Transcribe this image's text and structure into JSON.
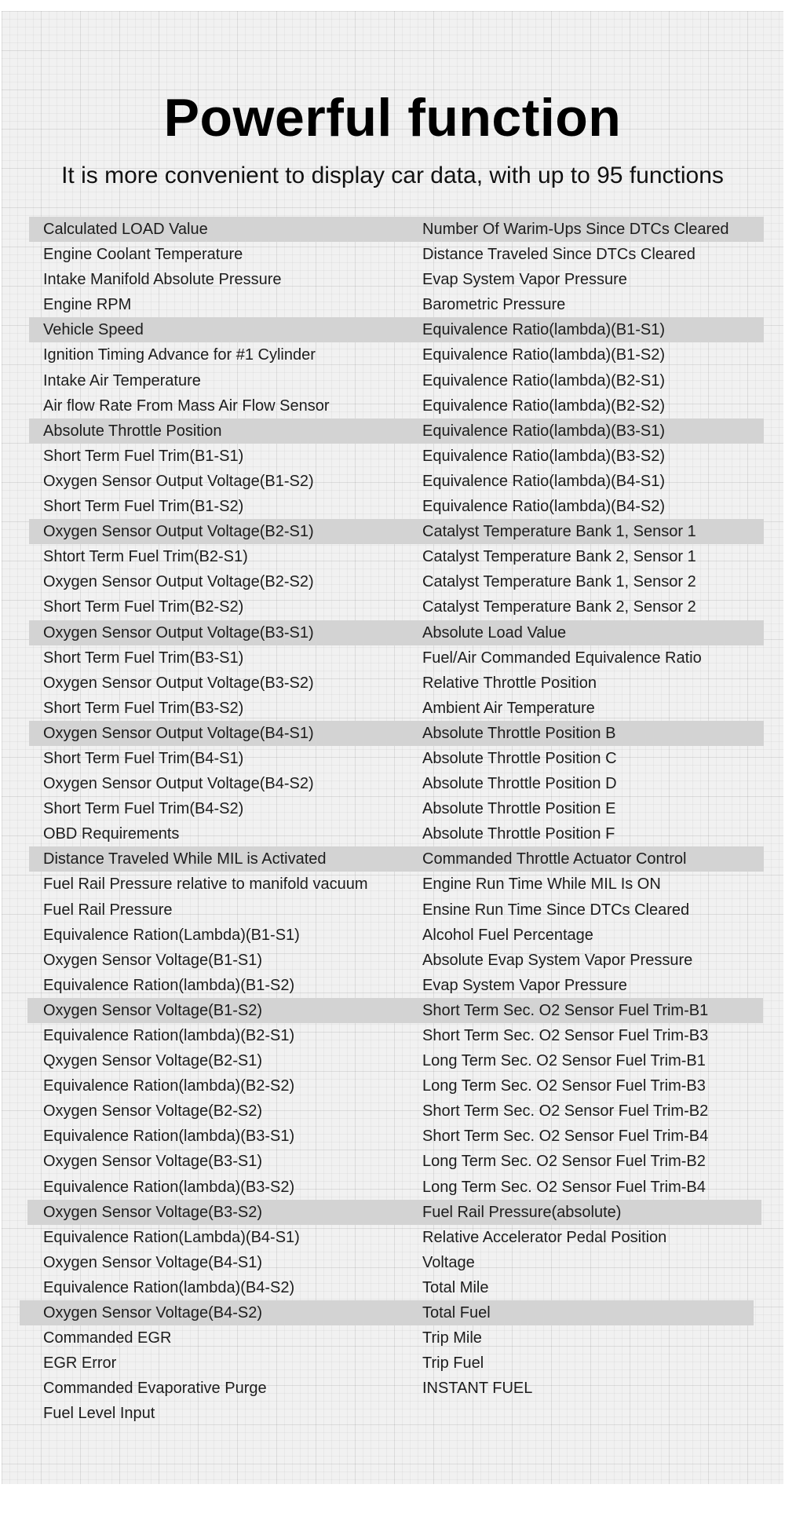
{
  "header": {
    "title": "Powerful function",
    "subtitle": "It is more convenient to display car data, with up to 95 functions"
  },
  "colors": {
    "highlight_band": "#d3d3d3",
    "panel_background": "#f1f1f1",
    "text": "#1c1c1c"
  },
  "functions": {
    "left_column": [
      "Calculated LOAD Value",
      "Engine Coolant Temperature",
      "Intake Manifold Absolute Pressure",
      "Engine RPM",
      "Vehicle Speed",
      "Ignition Timing Advance for #1 Cylinder",
      "Intake Air Temperature",
      "Air flow Rate From Mass Air Flow Sensor",
      "Absolute Throttle Position",
      "Short Term Fuel Trim(B1-S1)",
      "Oxygen Sensor Output Voltage(B1-S2)",
      "Short Term Fuel Trim(B1-S2)",
      "Oxygen Sensor Output Voltage(B2-S1)",
      "Shtort Term Fuel Trim(B2-S1)",
      "Oxygen Sensor Output Voltage(B2-S2)",
      "Short Term Fuel Trim(B2-S2)",
      "Oxygen Sensor Output Voltage(B3-S1)",
      "Short Term Fuel Trim(B3-S1)",
      "Oxygen Sensor Output Voltage(B3-S2)",
      "Short Term Fuel Trim(B3-S2)",
      "Oxygen Sensor Output Voltage(B4-S1)",
      "Short Term Fuel Trim(B4-S1)",
      "Oxygen Sensor Output Voltage(B4-S2)",
      "Short Term Fuel Trim(B4-S2)",
      "OBD Requirements",
      "Distance Traveled While MIL is Activated",
      "Fuel Rail Pressure relative to manifold vacuum",
      "Fuel Rail Pressure",
      "Equivalence Ration(Lambda)(B1-S1)",
      "Oxygen Sensor Voltage(B1-S1)",
      "Equivalence Ration(lambda)(B1-S2)",
      "Oxygen Sensor Voltage(B1-S2)",
      "Equivalence Ration(lambda)(B2-S1)",
      "Qxygen Sensor Voltage(B2-S1)",
      "Equivalence Ration(lambda)(B2-S2)",
      "Oxygen Sensor Voltage(B2-S2)",
      "Equivalence Ration(lambda)(B3-S1)",
      "Oxygen Sensor Voltage(B3-S1)",
      "Equivalence Ration(lambda)(B3-S2)",
      "Oxygen Sensor Voltage(B3-S2)",
      "Equivalence Ration(Lambda)(B4-S1)",
      "Oxygen Sensor Voltage(B4-S1)",
      "Equivalence Ration(lambda)(B4-S2)",
      "Oxygen Sensor Voltage(B4-S2)",
      "Commanded EGR",
      "EGR Error",
      "Commanded Evaporative Purge",
      "Fuel Level Input"
    ],
    "right_column": [
      "Number Of Warim-Ups Since DTCs Cleared",
      "Distance Traveled Since DTCs Cleared",
      "Evap System Vapor Pressure",
      "Barometric Pressure",
      "Equivalence Ratio(lambda)(B1-S1)",
      "Equivalence Ratio(lambda)(B1-S2)",
      "Equivalence Ratio(lambda)(B2-S1)",
      "Equivalence Ratio(lambda)(B2-S2)",
      "Equivalence Ratio(lambda)(B3-S1)",
      "Equivalence Ratio(lambda)(B3-S2)",
      "Equivalence Ratio(lambda)(B4-S1)",
      "Equivalence Ratio(lambda)(B4-S2)",
      "Catalyst Temperature Bank 1, Sensor 1",
      "Catalyst Temperature Bank 2, Sensor 1",
      "Catalyst Temperature Bank 1, Sensor 2",
      "Catalyst Temperature Bank 2, Sensor 2",
      "Absolute Load Value",
      "Fuel/Air Commanded Equivalence Ratio",
      "Relative Throttle Position",
      "Ambient Air Temperature",
      "Absolute Throttle Position B",
      "Absolute Throttle Position C",
      "Absolute Throttle Position D",
      "Absolute Throttle Position E",
      "Absolute Throttle Position F",
      "Commanded Throttle Actuator Control",
      "Engine Run Time While MIL Is ON",
      "Ensine Run Time Since DTCs Cleared",
      "Alcohol Fuel Percentage",
      "Absolute Evap System Vapor Pressure",
      "Evap System Vapor Pressure",
      "Short Term Sec. O2 Sensor Fuel Trim-B1",
      "Short Term Sec. O2 Sensor Fuel Trim-B3",
      "Long Term Sec. O2 Sensor Fuel Trim-B1",
      "Long Term Sec. O2 Sensor Fuel Trim-B3",
      "Short Term Sec. O2 Sensor Fuel Trim-B2",
      "Short Term Sec. O2 Sensor Fuel Trim-B4",
      "Long Term Sec. O2 Sensor Fuel Trim-B2",
      "Long Term Sec. O2 Sensor Fuel Trim-B4",
      "Fuel Rail Pressure(absolute)",
      "Relative Accelerator Pedal Position",
      "Voltage",
      "Total Mile",
      "Total Fuel",
      "Trip Mile",
      "Trip Fuel",
      "INSTANT FUEL"
    ],
    "highlighted_rows": [
      0,
      4,
      8,
      12,
      16,
      20,
      25,
      31,
      39,
      43
    ]
  }
}
